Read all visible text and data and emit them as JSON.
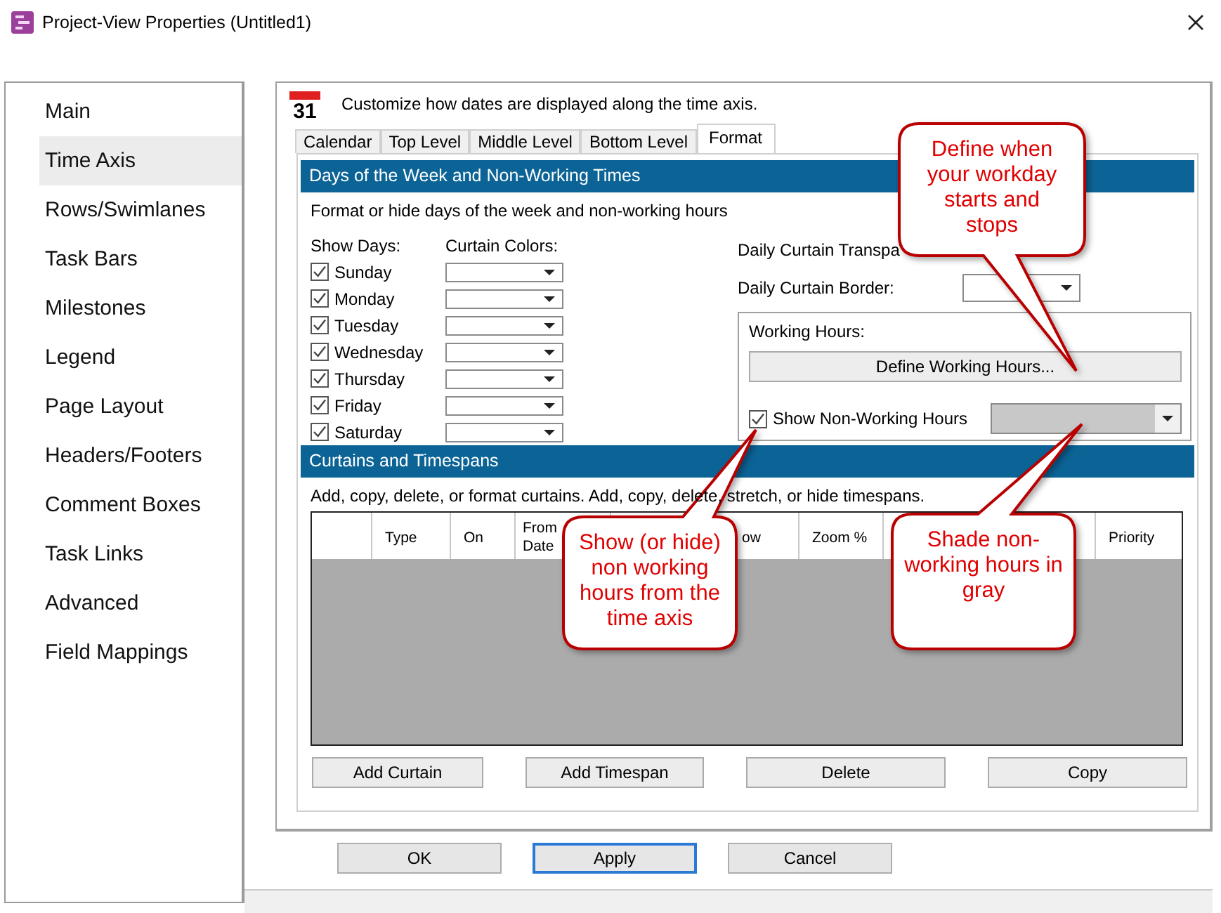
{
  "window": {
    "title": "Project-View Properties (Untitled1)"
  },
  "sidebar": {
    "items": [
      {
        "label": "Main",
        "selected": false
      },
      {
        "label": "Time Axis",
        "selected": true
      },
      {
        "label": "Rows/Swimlanes",
        "selected": false
      },
      {
        "label": "Task Bars",
        "selected": false
      },
      {
        "label": "Milestones",
        "selected": false
      },
      {
        "label": "Legend",
        "selected": false
      },
      {
        "label": "Page Layout",
        "selected": false
      },
      {
        "label": "Headers/Footers",
        "selected": false
      },
      {
        "label": "Comment Boxes",
        "selected": false
      },
      {
        "label": "Task Links",
        "selected": false
      },
      {
        "label": "Advanced",
        "selected": false
      },
      {
        "label": "Field Mappings",
        "selected": false
      }
    ]
  },
  "header": {
    "icon_day": "31",
    "text": "Customize how dates are displayed along the time axis."
  },
  "tabs": [
    {
      "label": "Calendar",
      "selected": false
    },
    {
      "label": "Top Level",
      "selected": false
    },
    {
      "label": "Middle Level",
      "selected": false
    },
    {
      "label": "Bottom Level",
      "selected": false
    },
    {
      "label": "Format",
      "selected": true
    }
  ],
  "days_section": {
    "title": "Days of the Week and Non-Working Times",
    "description": "Format or hide days of the week and non-working hours",
    "show_days_label": "Show Days:",
    "curtain_colors_label": "Curtain Colors:",
    "days": [
      {
        "label": "Sunday",
        "checked": true
      },
      {
        "label": "Monday",
        "checked": true
      },
      {
        "label": "Tuesday",
        "checked": true
      },
      {
        "label": "Wednesday",
        "checked": true
      },
      {
        "label": "Thursday",
        "checked": true
      },
      {
        "label": "Friday",
        "checked": true
      },
      {
        "label": "Saturday",
        "checked": true
      }
    ],
    "transparency_label": "Daily Curtain Transpa",
    "border_label": "Daily Curtain Border:",
    "working_hours": {
      "label": "Working Hours:",
      "button": "Define Working Hours...",
      "show_non_working": {
        "label": "Show Non-Working Hours",
        "checked": true,
        "color": "#c8c8c8"
      }
    }
  },
  "curtains_section": {
    "title": "Curtains and Timespans",
    "description": "Add, copy, delete, or format curtains.  Add, copy, delete, stretch, or hide timespans.",
    "columns": [
      {
        "label": "Type"
      },
      {
        "label": "On"
      },
      {
        "label": "From Date"
      },
      {
        "label": "ow"
      },
      {
        "label": "Zoom %"
      },
      {
        "label": "Priority"
      }
    ],
    "buttons": [
      "Add Curtain",
      "Add Timespan",
      "Delete",
      "Copy"
    ]
  },
  "dialog_buttons": [
    {
      "label": "OK",
      "focused": false
    },
    {
      "label": "Apply",
      "focused": true
    },
    {
      "label": "Cancel",
      "focused": false
    }
  ],
  "callouts": [
    {
      "text": "Define when your workday starts and stops"
    },
    {
      "text": "Show (or hide) non working hours from the time axis"
    },
    {
      "text": "Shade non-working hours in gray"
    }
  ]
}
